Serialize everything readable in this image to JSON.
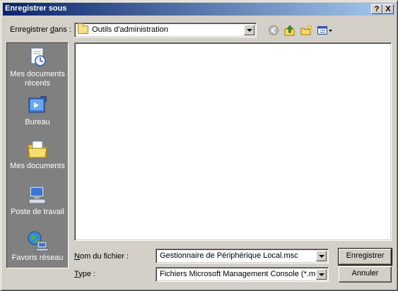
{
  "window": {
    "title": "Enregistrer sous",
    "help_button": "?",
    "close_button": "X"
  },
  "save_in": {
    "label_pre": "Enregistrer ",
    "label_accel": "d",
    "label_post": "ans :",
    "value": "Outils d'administration"
  },
  "toolbar": {
    "icons": [
      "back-icon",
      "up-folder-icon",
      "new-folder-icon",
      "view-menu-icon"
    ]
  },
  "places": [
    {
      "label": "Mes documents récents",
      "icon": "recent-documents-icon"
    },
    {
      "label": "Bureau",
      "icon": "desktop-icon"
    },
    {
      "label": "Mes documents",
      "icon": "my-documents-icon"
    },
    {
      "label": "Poste de travail",
      "icon": "my-computer-icon"
    },
    {
      "label": "Favoris réseau",
      "icon": "network-places-icon"
    }
  ],
  "filename": {
    "label_accel": "N",
    "label_post": "om du fichier :",
    "value": "Gestionnaire de Périphérique Local.msc"
  },
  "filetype": {
    "label_accel": "T",
    "label_post": "ype :",
    "value": "Fichiers Microsoft Management Console (*.msc)"
  },
  "buttons": {
    "save": "Enregistrer",
    "cancel": "Annuler"
  },
  "colors": {
    "title_start": "#0a246a",
    "title_end": "#a6caf0",
    "face": "#d4d0c8",
    "places_bg": "#808080"
  }
}
